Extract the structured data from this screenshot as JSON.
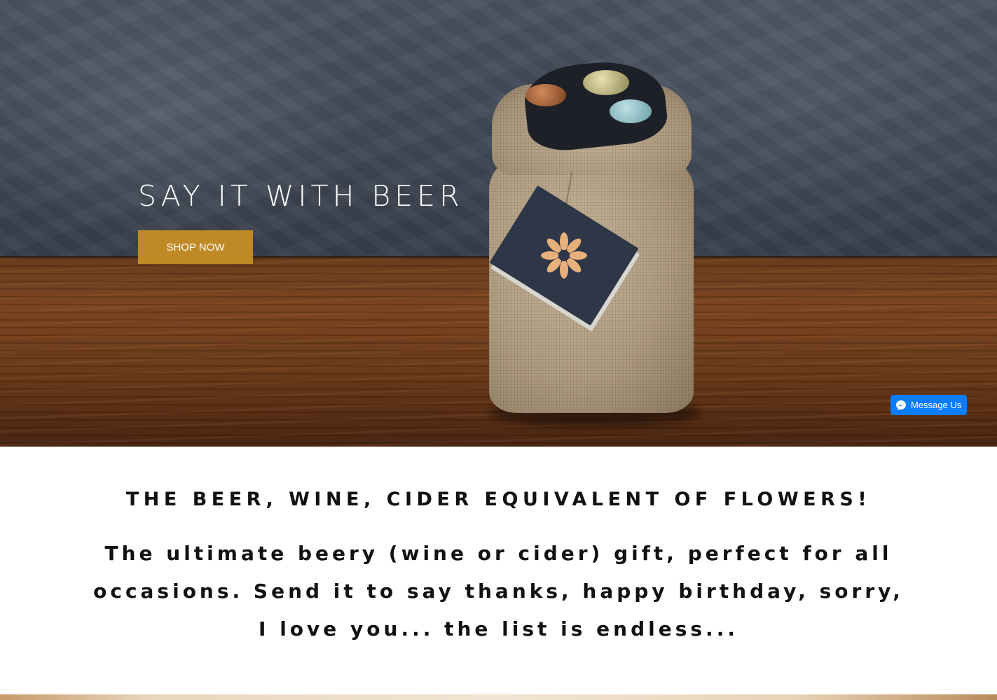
{
  "hero": {
    "title": "SAY IT WITH BEER",
    "cta_label": "SHOP NOW",
    "cta_color": "#bf8a26",
    "image": "burlap-gift-bag-with-beer-bottles"
  },
  "messenger": {
    "label": "Message Us",
    "icon": "messenger-icon",
    "color": "#0a7cff"
  },
  "intro": {
    "heading": "THE BEER, WINE, CIDER EQUIVALENT OF FLOWERS!",
    "body": "The ultimate beery (wine or cider) gift, perfect for all occasions. Send it to say thanks, happy birthday, sorry, I love you... the list is endless..."
  }
}
